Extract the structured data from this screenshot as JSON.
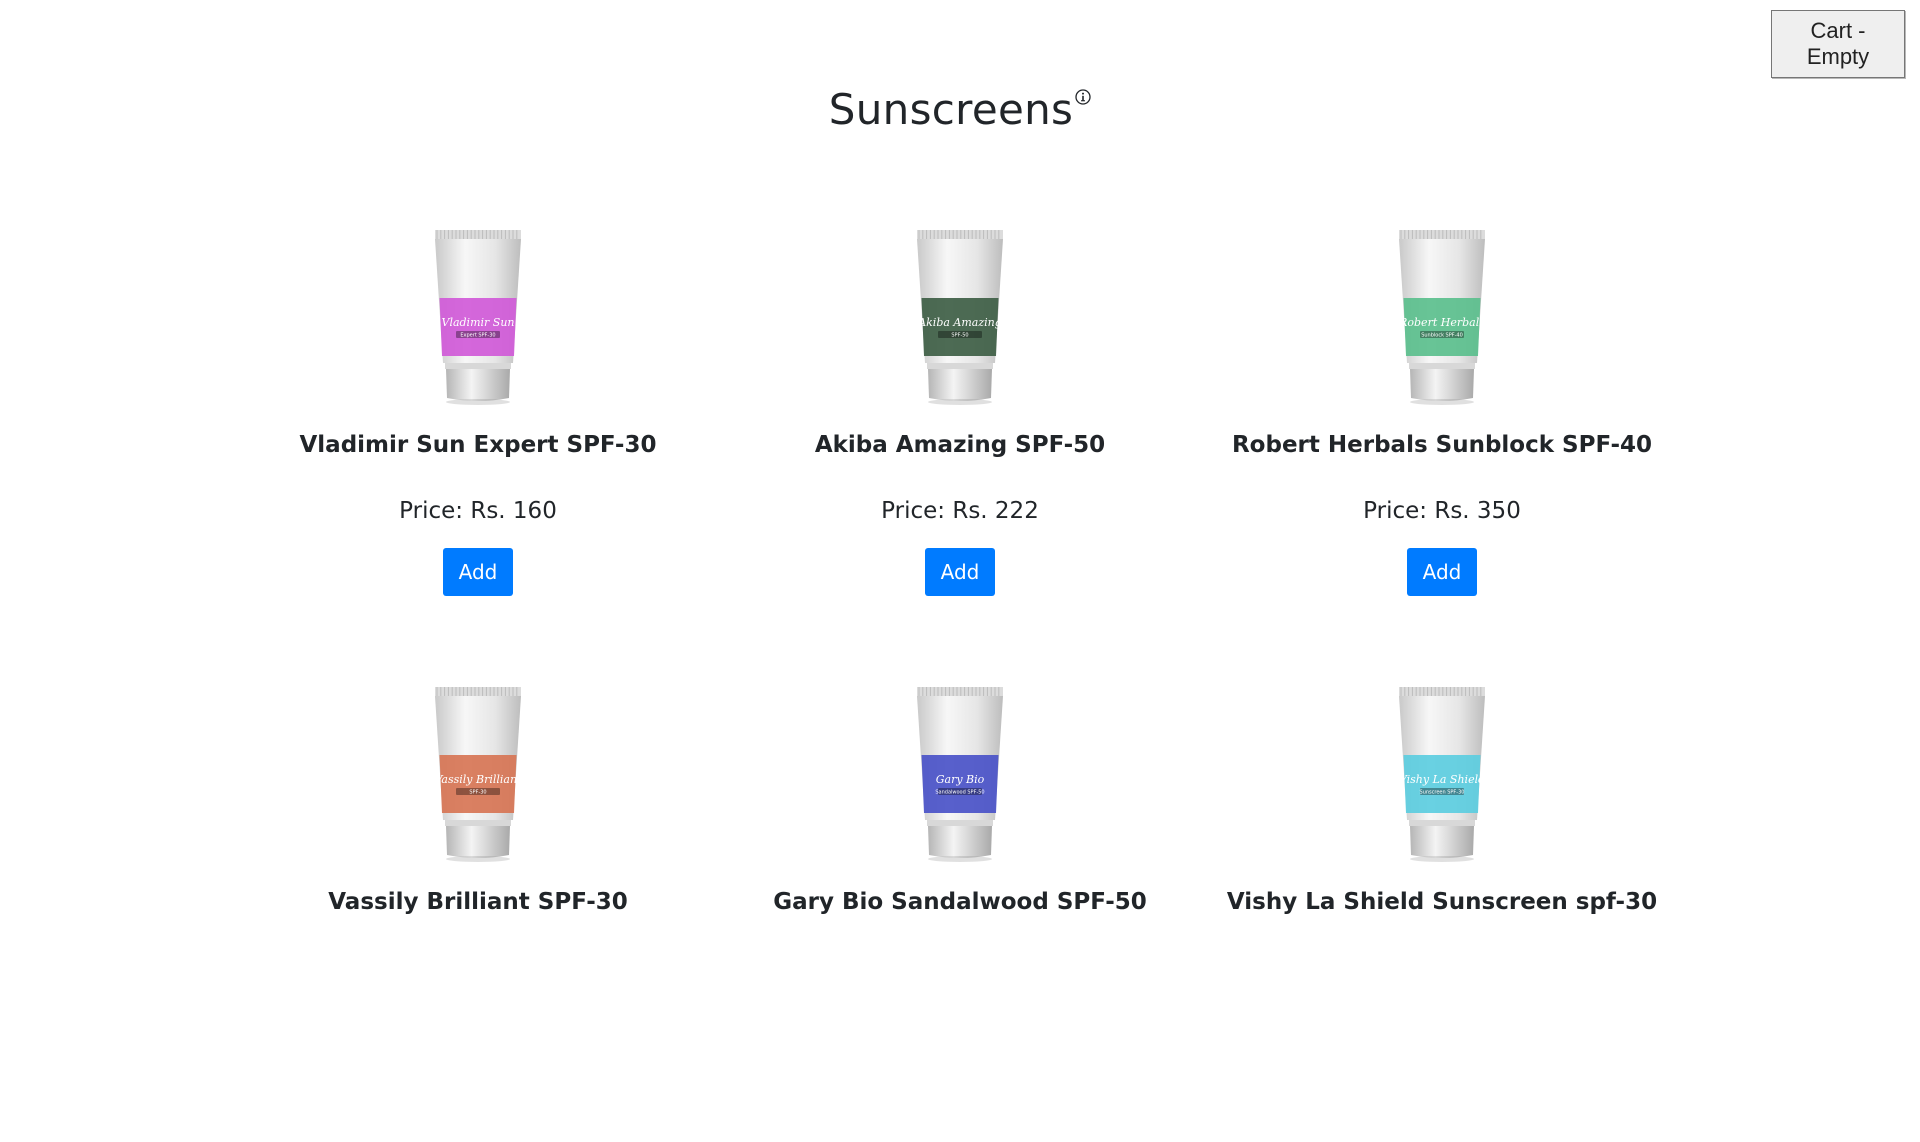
{
  "header": {
    "title": "Sunscreens",
    "info_icon": "info-circle-icon",
    "cart_label": "Cart - Empty"
  },
  "products": [
    {
      "name": "Vladimir Sun Expert SPF-30",
      "price": "Price: Rs. 160",
      "add_label": "Add",
      "band_color": "#d05ad8",
      "band_text": "Vladimir Sun",
      "band_sub": "Expert SPF-30"
    },
    {
      "name": "Akiba Amazing SPF-50",
      "price": "Price: Rs. 222",
      "add_label": "Add",
      "band_color": "#3e5e45",
      "band_text": "Akiba Amazing",
      "band_sub": "SPF-50"
    },
    {
      "name": "Robert Herbals Sunblock SPF-40",
      "price": "Price: Rs. 350",
      "add_label": "Add",
      "band_color": "#5bbf8d",
      "band_text": "Robert Herbals",
      "band_sub": "Sunblock SPF-40"
    },
    {
      "name": "Vassily Brilliant SPF-30",
      "price": "",
      "add_label": "",
      "band_color": "#d77555",
      "band_text": "Vassily Brilliant",
      "band_sub": "SPF-30"
    },
    {
      "name": "Gary Bio Sandalwood SPF-50",
      "price": "",
      "add_label": "",
      "band_color": "#4a52c8",
      "band_text": "Gary Bio",
      "band_sub": "Sandalwood SPF-50"
    },
    {
      "name": "Vishy La Shield Sunscreen spf-30",
      "price": "",
      "add_label": "",
      "band_color": "#5ccde0",
      "band_text": "Vishy La Shield",
      "band_sub": "Sunscreen SPF-30"
    }
  ],
  "colors": {
    "accent": "#007bff"
  }
}
